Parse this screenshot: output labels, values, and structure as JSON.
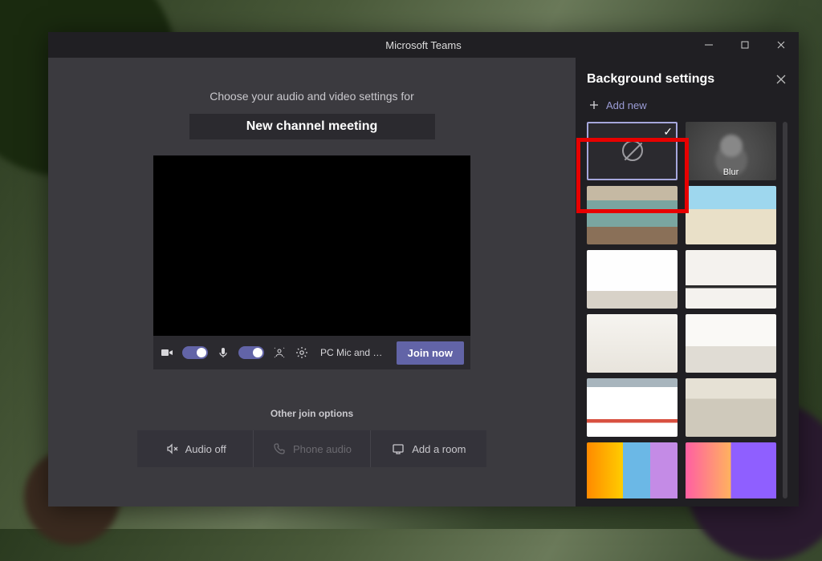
{
  "window": {
    "title": "Microsoft Teams"
  },
  "prejoin": {
    "prompt": "Choose your audio and video settings for",
    "meeting_title": "New channel meeting",
    "device_label": "PC Mic and Sp…",
    "join_label": "Join now",
    "other_options_heading": "Other join options",
    "options": {
      "audio_off": "Audio off",
      "phone_audio": "Phone audio",
      "add_room": "Add a room"
    }
  },
  "side": {
    "title": "Background settings",
    "add_new": "Add new",
    "tiles": {
      "none": "",
      "blur": "Blur"
    }
  }
}
